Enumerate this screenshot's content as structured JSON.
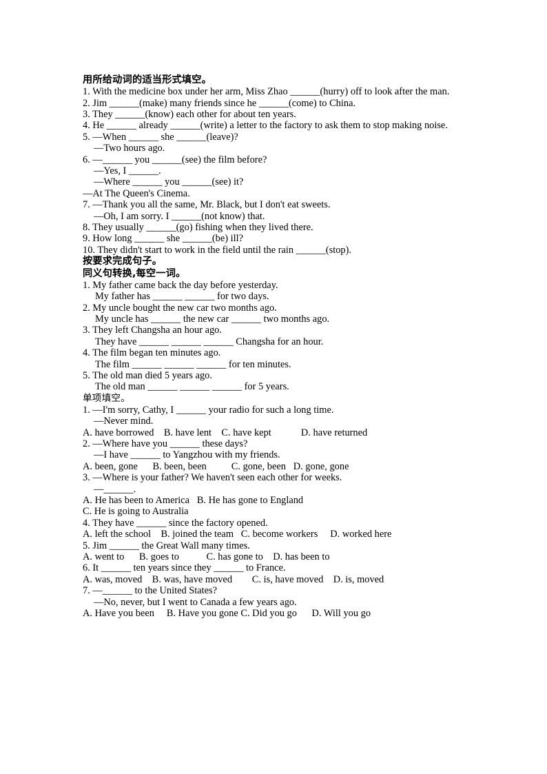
{
  "document": {
    "page_background": "#ffffff",
    "text_color": "#000000",
    "sections": [
      {
        "id": "verb-forms",
        "heading": "用所给动词的适当形式填空。",
        "heading_style": "bold",
        "lines": [
          {
            "text": "1. With the medicine box under her arm, Miss Zhao ______(hurry) off to look after the man.",
            "indent": "none"
          },
          {
            "text": "2. Jim ______(make) many friends since he ______(come) to China.",
            "indent": "none"
          },
          {
            "text": "3. They ______(know) each other for about ten years.",
            "indent": "none"
          },
          {
            "text": "4. He ______ already ______(write) a letter to the factory to ask them to stop making noise.",
            "indent": "none"
          },
          {
            "text": "5. —When ______ she ______(leave)?",
            "indent": "none"
          },
          {
            "text": "—Two hours ago.",
            "indent": "small"
          },
          {
            "text": "6. —______ you ______(see) the film before?",
            "indent": "none"
          },
          {
            "text": "—Yes, I ______.",
            "indent": "small"
          },
          {
            "text": "—Where ______ you ______(see) it?",
            "indent": "small"
          },
          {
            "text": "—At The Queen's Cinema.",
            "indent": "none"
          },
          {
            "text": "7. —Thank you all the same, Mr. Black, but I don't eat sweets.",
            "indent": "none"
          },
          {
            "text": "—Oh, I am sorry. I ______(not know) that.",
            "indent": "small"
          },
          {
            "text": "8. They usually ______(go) fishing when they lived there.",
            "indent": "none"
          },
          {
            "text": "9. How long ______ she ______(be) ill?",
            "indent": "none"
          },
          {
            "text": "10. They didn't start to work in the field until the rain ______(stop).",
            "indent": "none"
          }
        ]
      },
      {
        "id": "sentence-transformation",
        "heading": "按要求完成句子。",
        "heading_style": "bold",
        "subheading": "同义句转换,每空一词。",
        "subheading_style": "bold",
        "lines": [
          {
            "text": "1. My father came back the day before yesterday.",
            "indent": "none"
          },
          {
            "text": "My father has ______ ______ for two days.",
            "indent": "medium"
          },
          {
            "text": "2. My uncle bought the new car two months ago.",
            "indent": "none"
          },
          {
            "text": "My uncle has ______ the new car ______ two months ago.",
            "indent": "medium"
          },
          {
            "text": "3. They left Changsha an hour ago.",
            "indent": "none"
          },
          {
            "text": "They have ______ ______ ______ Changsha for an hour.",
            "indent": "medium"
          },
          {
            "text": "4. The film began ten minutes ago.",
            "indent": "none"
          },
          {
            "text": "The film ______ ______ ______ for ten minutes.",
            "indent": "medium"
          },
          {
            "text": "5. The old man died 5 years ago.",
            "indent": "none"
          },
          {
            "text": "The old man ______ ______ ______ for 5 years.",
            "indent": "medium"
          }
        ]
      },
      {
        "id": "multiple-choice",
        "heading": "单项填空。",
        "heading_style": "regular",
        "questions": [
          {
            "stem": "1. —I'm sorry, Cathy, I ______ your radio for such a long time.",
            "reply": "—Never mind.",
            "options": "A. have borrowed    B. have lent    C. have kept            D. have returned"
          },
          {
            "stem": "2. —Where have you ______ these days?",
            "reply": "—I have ______ to Yangzhou with my friends.",
            "options": "A. been, gone      B. been, been          C. gone, been   D. gone, gone"
          },
          {
            "stem": "3. —Where is your father? We haven't seen each other for weeks.",
            "reply": "—______.",
            "options": "A. He has been to America   B. He has gone to England",
            "options2": "C. He is going to Australia"
          },
          {
            "stem": "4. They have ______ since the factory opened.",
            "options": "A. left the school    B. joined the team   C. become workers     D. worked here"
          },
          {
            "stem": "5. Jim ______ the Great Wall many times.",
            "options": "A. went to      B. goes to           C. has gone to    D. has been to"
          },
          {
            "stem": "6. It ______ ten years since they ______ to France.",
            "options": "A. was, moved    B. was, have moved        C. is, have moved    D. is, moved"
          },
          {
            "stem": "7. —______ to the United States?",
            "reply": "—No, never, but I went to Canada a few years ago.",
            "options": "A. Have you been     B. Have you gone C. Did you go      D. Will you go"
          }
        ]
      }
    ]
  }
}
